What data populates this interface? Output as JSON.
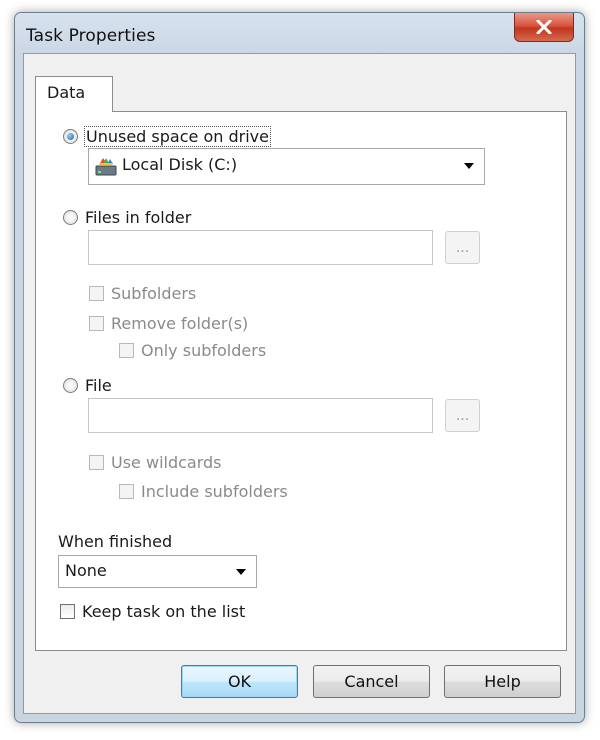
{
  "window": {
    "title": "Task Properties"
  },
  "tabs": [
    {
      "label": "Data"
    }
  ],
  "source": {
    "unused_space": {
      "label": "Unused space on drive",
      "checked": true,
      "drive_value": "Local Disk (C:)"
    },
    "files_in_folder": {
      "label": "Files in folder",
      "checked": false,
      "path_value": "",
      "browse_label": "...",
      "subfolders_label": "Subfolders",
      "remove_folders_label": "Remove folder(s)",
      "only_subfolders_label": "Only subfolders"
    },
    "file": {
      "label": "File",
      "checked": false,
      "path_value": "",
      "browse_label": "...",
      "use_wildcards_label": "Use wildcards",
      "include_subfolders_label": "Include subfolders"
    }
  },
  "when_finished": {
    "label": "When finished",
    "value": "None"
  },
  "keep_task": {
    "label": "Keep task on the list",
    "checked": false
  },
  "buttons": {
    "ok": "OK",
    "cancel": "Cancel",
    "help": "Help"
  },
  "icons": {
    "close": "close-icon",
    "drive": "hard-drive-icon",
    "dropdown": "chevron-down-icon"
  },
  "colors": {
    "close_button": "#c8432c",
    "default_button": "#bee6fd",
    "selected_radio": "#1b5fa8"
  }
}
